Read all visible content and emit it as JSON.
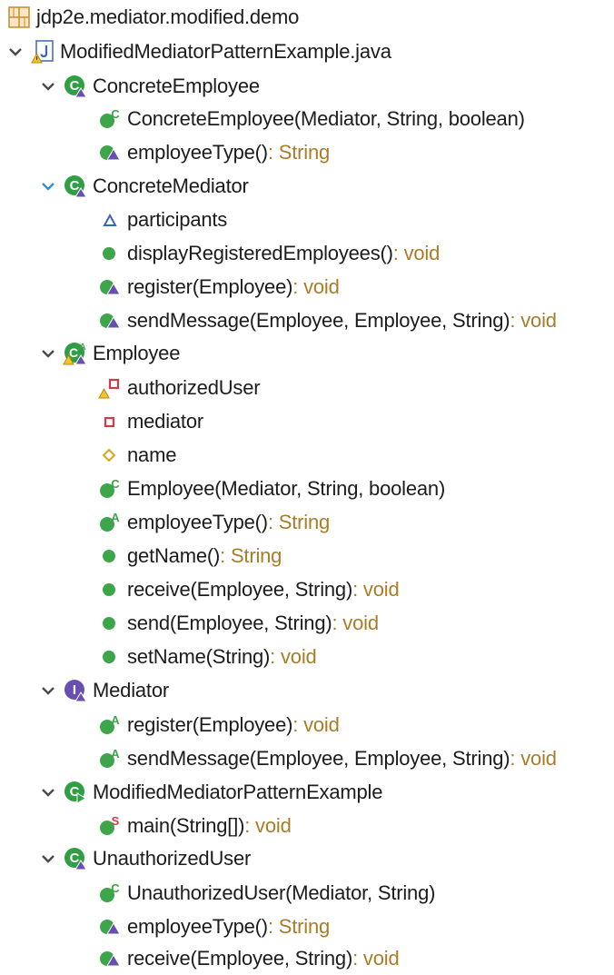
{
  "tree": {
    "package": {
      "label": "jdp2e.mediator.modified.demo",
      "icon": "package-icon"
    },
    "file": {
      "label": "ModifiedMediatorPatternExample.java",
      "icon": "java-file-warning-icon"
    },
    "concrete_employee": {
      "label": "ConcreteEmployee",
      "icon": "class-abstract-icon",
      "members": [
        {
          "label": "ConcreteEmployee(Mediator, String, boolean)",
          "type": "",
          "icon": "constructor-icon"
        },
        {
          "label": "employeeType()",
          "type": " : String",
          "icon": "override-method-icon"
        }
      ]
    },
    "concrete_mediator": {
      "label": "ConcreteMediator",
      "icon": "class-abstract-icon",
      "members": [
        {
          "label": "participants",
          "type": "",
          "icon": "default-field-icon"
        },
        {
          "label": "displayRegisteredEmployees()",
          "type": " : void",
          "icon": "public-method-icon"
        },
        {
          "label": "register(Employee)",
          "type": " : void",
          "icon": "override-method-icon"
        },
        {
          "label": "sendMessage(Employee, Employee, String)",
          "type": " : void",
          "icon": "override-method-icon"
        }
      ]
    },
    "employee": {
      "label": "Employee",
      "icon": "abstract-class-warning-icon",
      "members": [
        {
          "label": "authorizedUser",
          "type": "",
          "icon": "private-field-warning-icon"
        },
        {
          "label": "mediator",
          "type": "",
          "icon": "private-field-icon"
        },
        {
          "label": "name",
          "type": "",
          "icon": "protected-field-icon"
        },
        {
          "label": "Employee(Mediator, String, boolean)",
          "type": "",
          "icon": "constructor-icon"
        },
        {
          "label": "employeeType()",
          "type": " : String",
          "icon": "abstract-method-icon"
        },
        {
          "label": "getName()",
          "type": " : String",
          "icon": "public-method-icon"
        },
        {
          "label": "receive(Employee, String)",
          "type": " : void",
          "icon": "public-method-icon"
        },
        {
          "label": "send(Employee, String)",
          "type": " : void",
          "icon": "public-method-icon"
        },
        {
          "label": "setName(String)",
          "type": " : void",
          "icon": "public-method-icon"
        }
      ]
    },
    "mediator": {
      "label": "Mediator",
      "icon": "interface-icon",
      "members": [
        {
          "label": "register(Employee)",
          "type": " : void",
          "icon": "abstract-method-icon"
        },
        {
          "label": "sendMessage(Employee, Employee, String)",
          "type": " : void",
          "icon": "abstract-method-icon"
        }
      ]
    },
    "main_class": {
      "label": "ModifiedMediatorPatternExample",
      "icon": "class-main-icon",
      "members": [
        {
          "label": "main(String[])",
          "type": " : void",
          "icon": "static-method-icon"
        }
      ]
    },
    "unauthorized_user": {
      "label": "UnauthorizedUser",
      "icon": "class-abstract-icon",
      "members": [
        {
          "label": "UnauthorizedUser(Mediator, String)",
          "type": "",
          "icon": "constructor-icon"
        },
        {
          "label": "employeeType()",
          "type": " : String",
          "icon": "override-method-icon"
        },
        {
          "label": "receive(Employee, String)",
          "type": " : void",
          "icon": "override-method-icon"
        }
      ]
    }
  },
  "colors": {
    "text": "#1c1c1c",
    "return_type": "#a97c27",
    "method_green": "#3ea64a",
    "class_green": "#2f9e44",
    "interface_purple": "#6a4fb3",
    "field_blue": "#3a63c4",
    "private_red": "#d23a4a",
    "protected_gold": "#d9a520",
    "warning_yellow": "#f4c430",
    "twisty_grey": "#4a4a4a",
    "twisty_blue": "#2f8fd8"
  }
}
